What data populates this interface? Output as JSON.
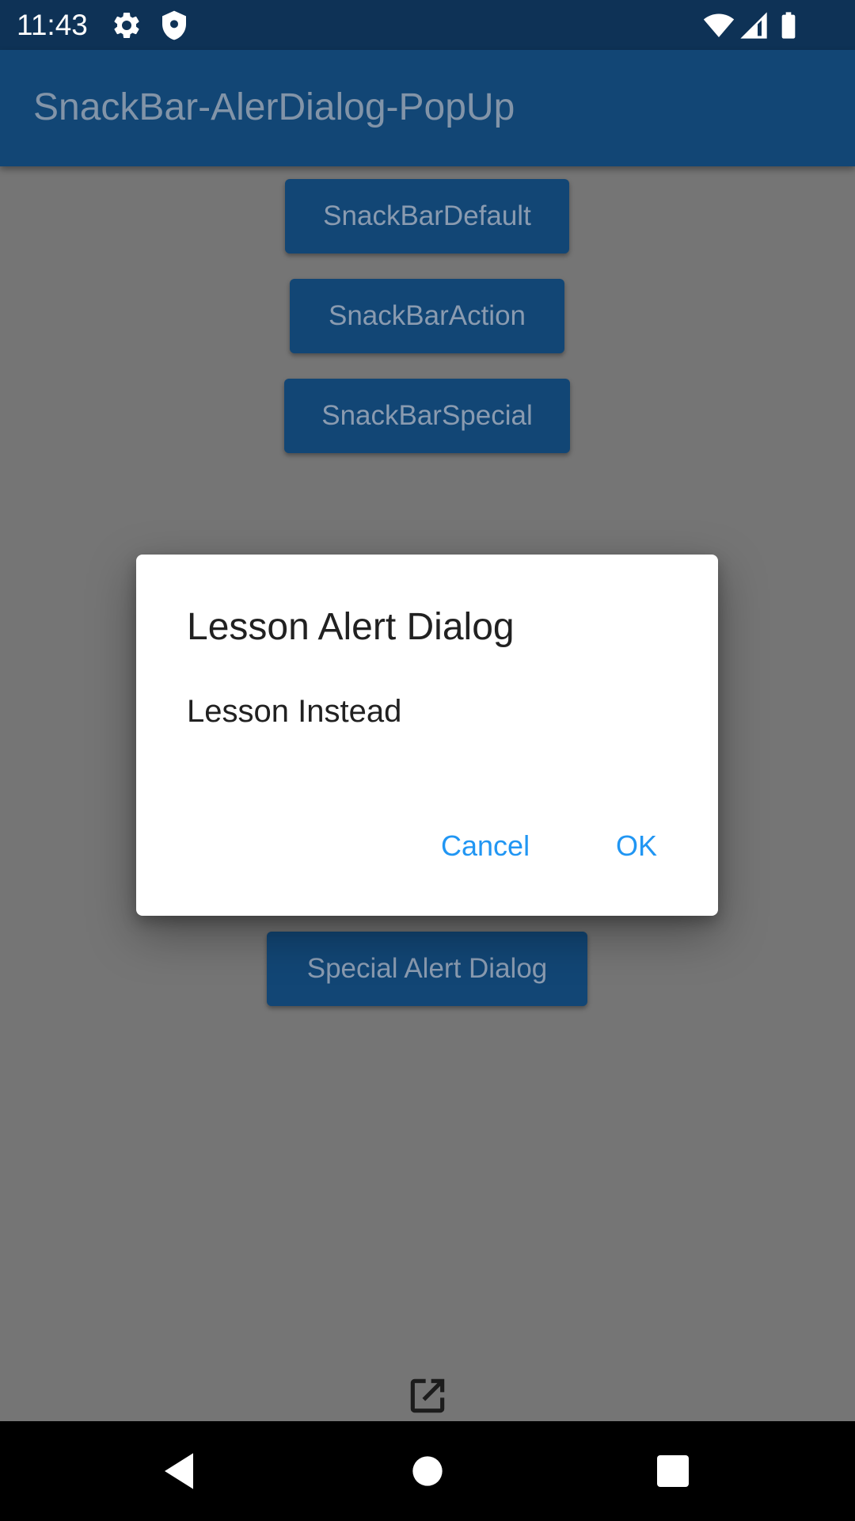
{
  "status_bar": {
    "time": "11:43",
    "icons": [
      "settings-icon",
      "shield-icon",
      "wifi-icon",
      "signal-icon",
      "battery-icon"
    ]
  },
  "app_bar": {
    "title": "SnackBar-AlerDialog-PopUp"
  },
  "buttons": {
    "snackbar_default": "SnackBarDefault",
    "snackbar_action": "SnackBarAction",
    "snackbar_special": "SnackBarSpecial",
    "special_alert_dialog": "Special Alert Dialog"
  },
  "dialog": {
    "title": "Lesson Alert Dialog",
    "message": "Lesson Instead",
    "cancel_label": "Cancel",
    "ok_label": "OK"
  },
  "colors": {
    "status_bar": "#0e3256",
    "app_bar": "#124675",
    "scrim_background": "#757575",
    "dialog_accent": "#2196f3"
  },
  "nav_bar": {
    "icons": [
      "back-icon",
      "home-icon",
      "recents-icon"
    ]
  }
}
